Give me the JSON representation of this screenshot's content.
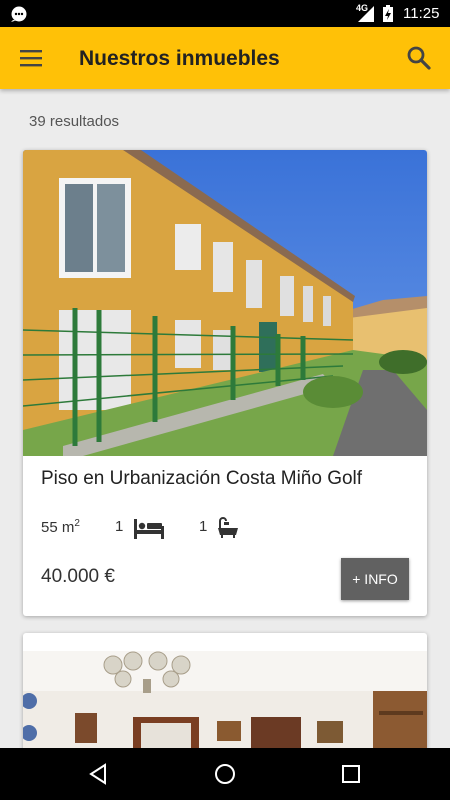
{
  "status_bar": {
    "network": "4G",
    "time": "11:25"
  },
  "app_bar": {
    "title": "Nuestros inmuebles",
    "menu_icon": "menu-icon",
    "search_icon": "search-icon"
  },
  "results": {
    "count_text": "39 resultados"
  },
  "listings": [
    {
      "title": "Piso en Urbanización Costa Miño Golf",
      "area_value": "55 m",
      "area_unit_exp": "2",
      "bedrooms": "1",
      "bathrooms": "1",
      "price": "40.000 €",
      "info_button": "+ INFO"
    }
  ],
  "colors": {
    "accent": "#ffc107",
    "button": "#616161"
  }
}
